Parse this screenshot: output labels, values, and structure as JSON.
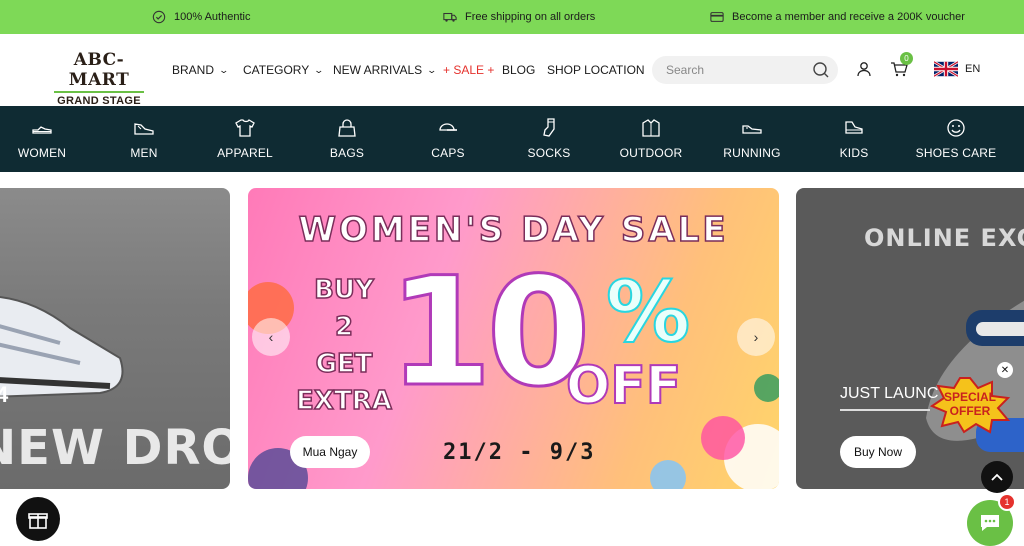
{
  "topbar": {
    "authentic": "100% Authentic",
    "shipping": "Free shipping on all orders",
    "member": "Become a member and receive a 200K voucher",
    "authentic_icon": "shield-check-icon",
    "shipping_icon": "truck-icon",
    "member_icon": "card-icon"
  },
  "header": {
    "logo_line1": "ABC-MART",
    "logo_line2": "GRAND STAGE",
    "nav": {
      "brand": "BRAND",
      "category": "CATEGORY",
      "new_arrivals": "NEW ARRIVALS",
      "sale": "+ SALE +",
      "blog": "BLOG",
      "shop_location": "SHOP LOCATION"
    },
    "search_placeholder": "Search",
    "cart_count": "0",
    "language": "EN"
  },
  "categories": [
    {
      "label": "WOMEN",
      "icon": "women-shoe-icon"
    },
    {
      "label": "MEN",
      "icon": "men-shoe-icon"
    },
    {
      "label": "APPAREL",
      "icon": "tshirt-icon"
    },
    {
      "label": "BAGS",
      "icon": "bag-icon"
    },
    {
      "label": "CAPS",
      "icon": "cap-icon"
    },
    {
      "label": "SOCKS",
      "icon": "sock-icon"
    },
    {
      "label": "OUTDOOR",
      "icon": "jacket-icon"
    },
    {
      "label": "RUNNING",
      "icon": "running-shoe-icon"
    },
    {
      "label": "KIDS",
      "icon": "kids-shoe-icon"
    },
    {
      "label": "SHOES CARE",
      "icon": "smile-icon"
    }
  ],
  "banners": {
    "left": {
      "headline": "NEW DROP",
      "number": "4"
    },
    "center": {
      "title": "WOMEN'S DAY SALE",
      "buy_lines": [
        "BUY",
        "2",
        "GET",
        "EXTRA"
      ],
      "big_number": "10",
      "percent": "%",
      "off": "OFF",
      "dates": "21/2 - 9/3",
      "cta": "Mua Ngay"
    },
    "right": {
      "headline": "ONLINE EXC",
      "tagline": "JUST LAUNC",
      "cta": "Buy Now",
      "badge_line1": "SPECIAL",
      "badge_line2": "OFFER"
    }
  },
  "floating": {
    "chat_badge": "1"
  },
  "colors": {
    "topbar": "#7ed957",
    "catbar": "#0f2b33",
    "sale": "#e5322d",
    "accent": "#6ac045"
  }
}
